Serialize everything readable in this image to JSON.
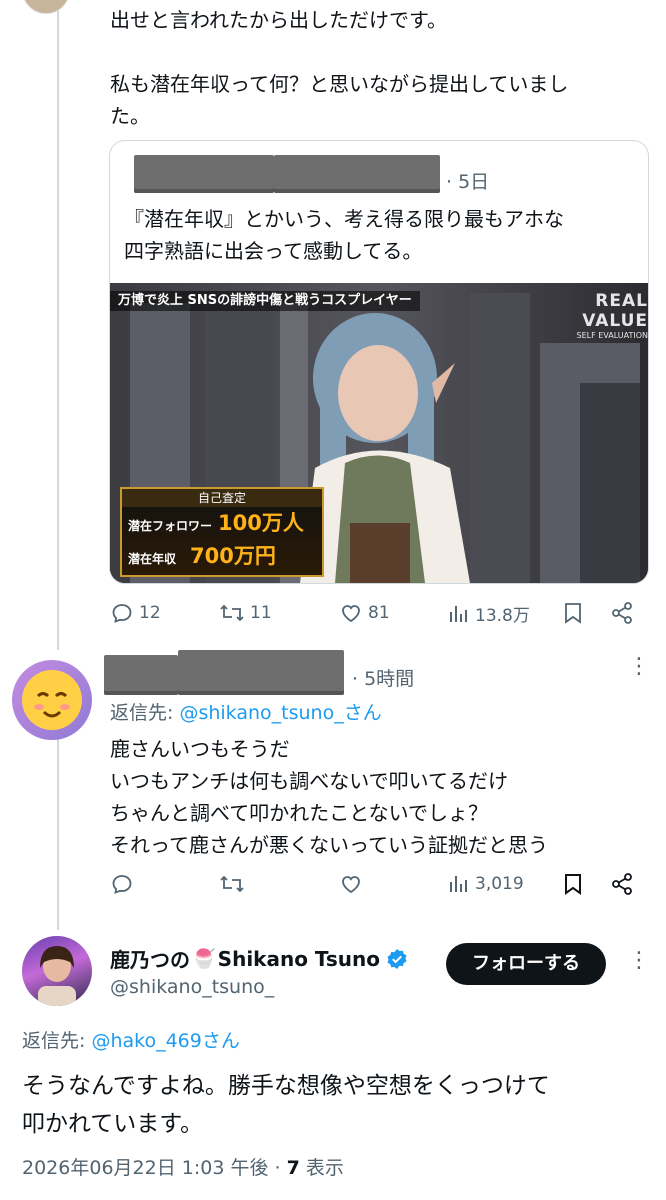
{
  "tweet1": {
    "text_line1": "出せと言われたから出しただけです。",
    "text_line2": "私も潜在年収って何？と思いながら提出していまし",
    "text_line3": "た。",
    "quote": {
      "time": "· 5日",
      "text_line1": "『潜在年収』とかいう、考え得る限り最もアホな",
      "text_line2": "四字熟語に出会って感動してる。",
      "image": {
        "top_banner": "万博で炎上 SNSの誹謗中傷と戦うコスプレイヤー",
        "top_right": "REAL VALUE",
        "top_right_sub": "SELF EVALUATION",
        "caption_header": "自己査定",
        "row1_label": "潜在フォロワー",
        "row1_value": "100万人",
        "row2_label": "潜在年収",
        "row2_value": "700万円"
      }
    },
    "actions": {
      "replies": "12",
      "retweets": "11",
      "likes": "81",
      "views": "13.8万"
    }
  },
  "tweet2": {
    "time": "· 5時間",
    "reply_to_label": "返信先: ",
    "reply_to_handle": "@shikano_tsuno_さん",
    "lines": [
      "鹿さんいつもそうだ",
      "いつもアンチは何も調べないで叩いてるだけ",
      "ちゃんと調べて叩かれたことないでしょ？",
      "それって鹿さんが悪くないっていう証拠だと思う"
    ],
    "actions": {
      "views": "3,019"
    }
  },
  "main": {
    "name_prefix": "鹿乃つの",
    "emoji": "🍧",
    "name_suffix": "Shikano Tsuno",
    "handle": "@shikano_tsuno_",
    "follow_label": "フォローする",
    "reply_to_label": "返信先: ",
    "reply_to_handle": "@hako_469さん",
    "text_line1": "そうなんですよね。勝手な想像や空想をくっつけて",
    "text_line2": "叩かれています。",
    "timestamp": "2026年06月22日 1:03 午後",
    "views_sep": " · ",
    "views_count": "7",
    "views_label": " 表示"
  },
  "colors": {
    "verified": "#1d9bf0",
    "follow_bg": "#0f1419",
    "link": "#1d9bf0",
    "meta": "#536471"
  }
}
